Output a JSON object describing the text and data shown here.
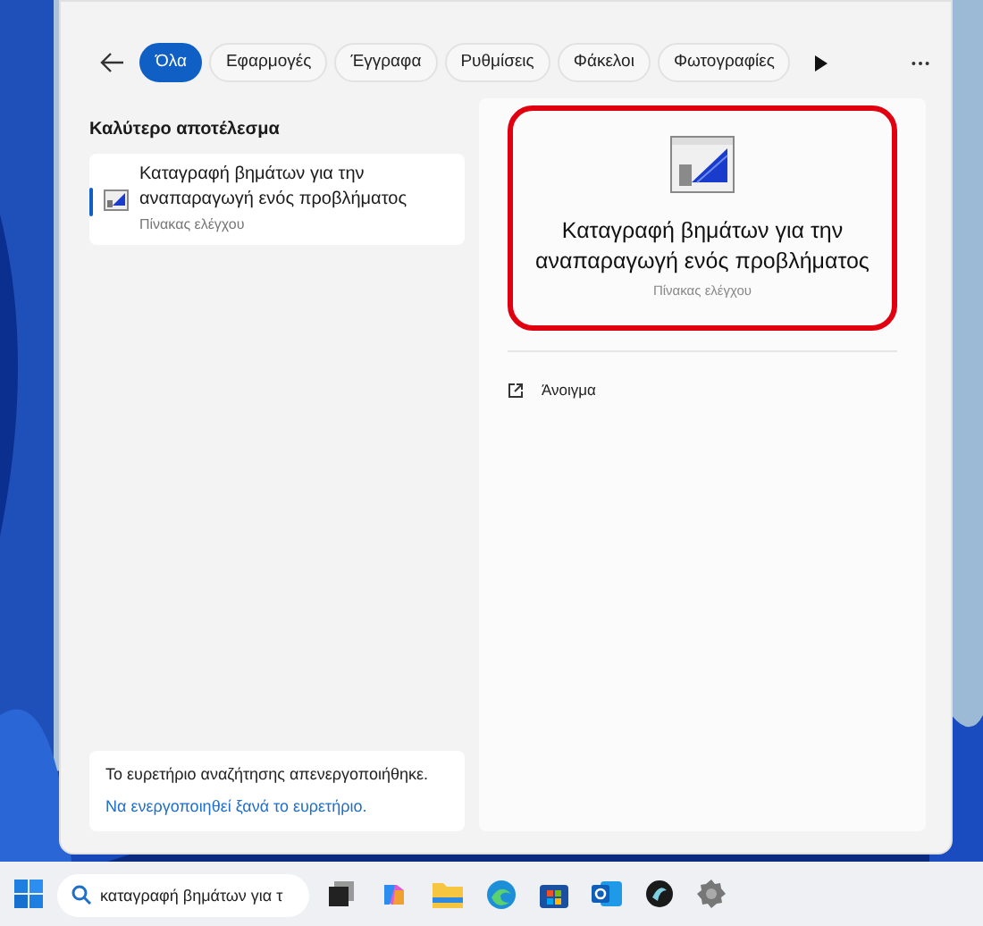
{
  "tabs": [
    {
      "label": "Όλα",
      "selected": true
    },
    {
      "label": "Εφαρμογές",
      "selected": false
    },
    {
      "label": "Έγγραφα",
      "selected": false
    },
    {
      "label": "Ρυθμίσεις",
      "selected": false
    },
    {
      "label": "Φάκελοι",
      "selected": false
    },
    {
      "label": "Φωτογραφίες",
      "selected": false
    }
  ],
  "best_match": {
    "heading": "Καλύτερο αποτέλεσμα",
    "title": "Καταγραφή βημάτων για την αναπαραγωγή ενός προβλήματος",
    "subtitle": "Πίνακας ελέγχου",
    "selected": true
  },
  "index_notice": {
    "message": "Το ευρετήριο αναζήτησης απενεργοποιήθηκε.",
    "link": "Να ενεργοποιηθεί ξανά το ευρετήριο."
  },
  "preview": {
    "title": "Καταγραφή βημάτων για την αναπαραγωγή ενός προβλήματος",
    "subtitle": "Πίνακας ελέγχου",
    "highlighted": true,
    "actions": [
      {
        "label": "Άνοιγμα"
      }
    ]
  },
  "taskbar": {
    "search_value": "καταγραφή βημάτων για τ"
  }
}
